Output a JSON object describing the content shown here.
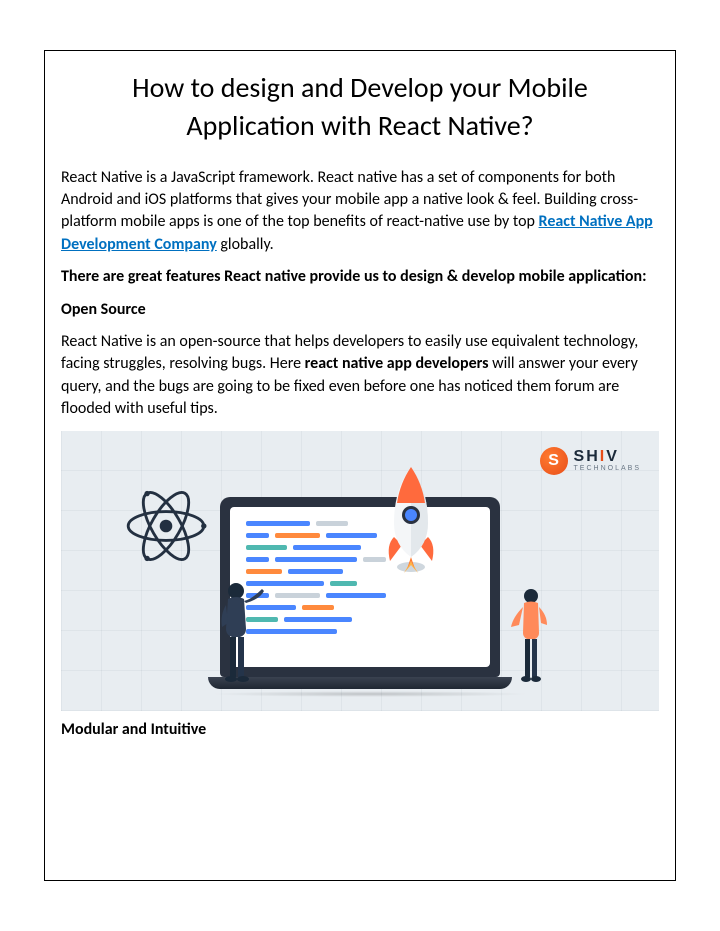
{
  "title": "How to design and Develop your Mobile Application with React Native?",
  "intro": {
    "pre": "React Native is a JavaScript framework. React native has a set of components for both Android and iOS platforms that gives your mobile app a native look & feel. Building cross-platform mobile apps is one of the top benefits of react-native use by top ",
    "link": "React Native App Development Company",
    "post": " globally."
  },
  "features_lead": "There are great features React native provide us to design & develop mobile application:",
  "open_source_head": "Open Source",
  "open_source_body": {
    "pre": "React Native is an open-source that helps developers to easily use equivalent technology, facing struggles, resolving bugs. Here ",
    "bold": "react native app developers",
    "post": " will answer your every query, and the bugs are going to be fixed even before one has noticed them forum are flooded with useful tips."
  },
  "brand": {
    "name_part1": "SH",
    "name_accent": "I",
    "name_part2": "V",
    "tagline": "TECHNOLABS"
  },
  "modular_head": "Modular and Intuitive"
}
